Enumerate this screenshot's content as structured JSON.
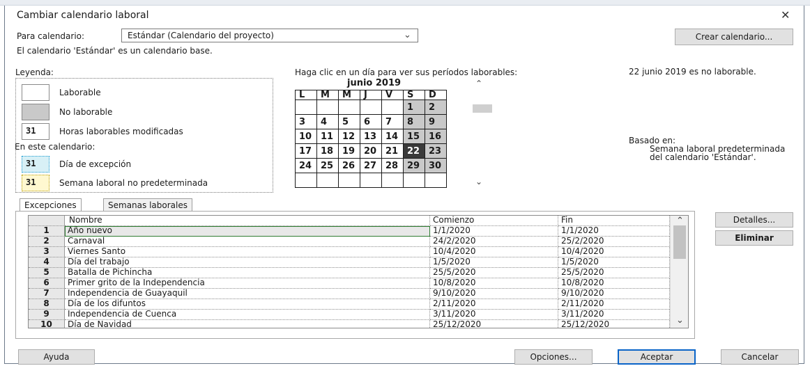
{
  "title": "Cambiar calendario laboral",
  "close_glyph": "✕",
  "calendar_select": {
    "label": "Para calendario:",
    "value": "Estándar (Calendario del proyecto)"
  },
  "create_calendar_button": "Crear calendario...",
  "base_note": "El calendario 'Estándar' es un calendario base.",
  "legend": {
    "heading": "Leyenda:",
    "working": "Laborable",
    "nonworking": "No laborable",
    "modified_hours": "Horas laborables modificadas",
    "in_this_calendar": "En este calendario:",
    "exception_day": "Día de excepción",
    "nondefault_week": "Semana laboral no predeterminada",
    "sample_day": "31"
  },
  "calendar": {
    "instruction": "Haga clic en un día para ver sus períodos laborables:",
    "month": "junio 2019",
    "weekdays": [
      "L",
      "M",
      "M",
      "J",
      "V",
      "S",
      "D"
    ],
    "weeks": [
      [
        "",
        "",
        "",
        "",
        "",
        "1",
        "2"
      ],
      [
        "3",
        "4",
        "5",
        "6",
        "7",
        "8",
        "9"
      ],
      [
        "10",
        "11",
        "12",
        "13",
        "14",
        "15",
        "16"
      ],
      [
        "17",
        "18",
        "19",
        "20",
        "21",
        "22",
        "23"
      ],
      [
        "24",
        "25",
        "26",
        "27",
        "28",
        "29",
        "30"
      ],
      [
        "",
        "",
        "",
        "",
        "",
        "",
        ""
      ]
    ],
    "selected_day": "22"
  },
  "day_info": "22 junio 2019 es no laborable.",
  "based_on": {
    "heading": "Basado en:",
    "text": "Semana laboral predeterminada del calendario 'Estándar'."
  },
  "tabs": [
    "Excepciones",
    "Semanas laborales"
  ],
  "columns": [
    "Nombre",
    "Comienzo",
    "Fin"
  ],
  "exceptions": [
    {
      "n": "1",
      "name": "Año nuevo",
      "start": "1/1/2020",
      "end": "1/1/2020"
    },
    {
      "n": "2",
      "name": "Carnaval",
      "start": "24/2/2020",
      "end": "25/2/2020"
    },
    {
      "n": "3",
      "name": "Viernes Santo",
      "start": "10/4/2020",
      "end": "10/4/2020"
    },
    {
      "n": "4",
      "name": "Día del trabajo",
      "start": "1/5/2020",
      "end": "1/5/2020"
    },
    {
      "n": "5",
      "name": "Batalla de Pichincha",
      "start": "25/5/2020",
      "end": "25/5/2020"
    },
    {
      "n": "6",
      "name": "Primer grito de la Independencia",
      "start": "10/8/2020",
      "end": "10/8/2020"
    },
    {
      "n": "7",
      "name": "Independencia de Guayaquil",
      "start": "9/10/2020",
      "end": "9/10/2020"
    },
    {
      "n": "8",
      "name": "Día de los difuntos",
      "start": "2/11/2020",
      "end": "2/11/2020"
    },
    {
      "n": "9",
      "name": "Independencia de Cuenca",
      "start": "3/11/2020",
      "end": "3/11/2020"
    },
    {
      "n": "10",
      "name": "Día de Navidad",
      "start": "25/12/2020",
      "end": "25/12/2020"
    }
  ],
  "buttons": {
    "details": "Detalles...",
    "delete": "Eliminar",
    "help": "Ayuda",
    "options": "Opciones...",
    "accept": "Aceptar",
    "cancel": "Cancelar"
  },
  "colors": {
    "accent": "#0a64c8",
    "nonworking": "#c9c9c9",
    "selected_day": "#3a3a3a",
    "exception": "#d8f0f6",
    "nondefault_week": "#fff8d0"
  },
  "icons": {
    "dropdown": "chevron-down-icon",
    "scroll_up": "chevron-up-icon",
    "scroll_down": "chevron-down-icon",
    "close": "close-icon"
  }
}
